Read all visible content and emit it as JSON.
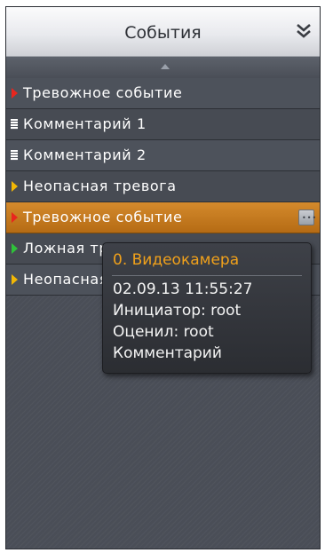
{
  "header": {
    "title": "События",
    "collapse_icon": "double-chevron-down-icon"
  },
  "scroll": {
    "icon": "scroll-up-arrow-icon"
  },
  "events": [
    {
      "label": "Тревожное событие",
      "marker": "red-triangle",
      "color": "#e8261e"
    },
    {
      "label": "Комментарий 1",
      "marker": "comment-note",
      "color": "#ffffff"
    },
    {
      "label": "Комментарий 2",
      "marker": "comment-note",
      "color": "#ffffff"
    },
    {
      "label": "Неопасная тревога",
      "marker": "yellow-triangle",
      "color": "#f2b705"
    },
    {
      "label": "Тревожное событие",
      "marker": "red-triangle",
      "color": "#e8261e",
      "selected": true
    },
    {
      "label": "Ложная тревога",
      "marker": "green-triangle",
      "color": "#2fc13a"
    },
    {
      "label": "Неопасная тревога",
      "marker": "yellow-triangle",
      "color": "#f2b705"
    }
  ],
  "tooltip": {
    "title": "0. Видеокамера",
    "datetime": "02.09.13 11:55:27",
    "initiator": "Инициатор: root",
    "evaluated": "Оценил: root",
    "comment": "Комментарий"
  },
  "colors": {
    "accent": "#f0a11b",
    "selected_row": "#c97a20",
    "panel_bg": "#4a4e57"
  }
}
